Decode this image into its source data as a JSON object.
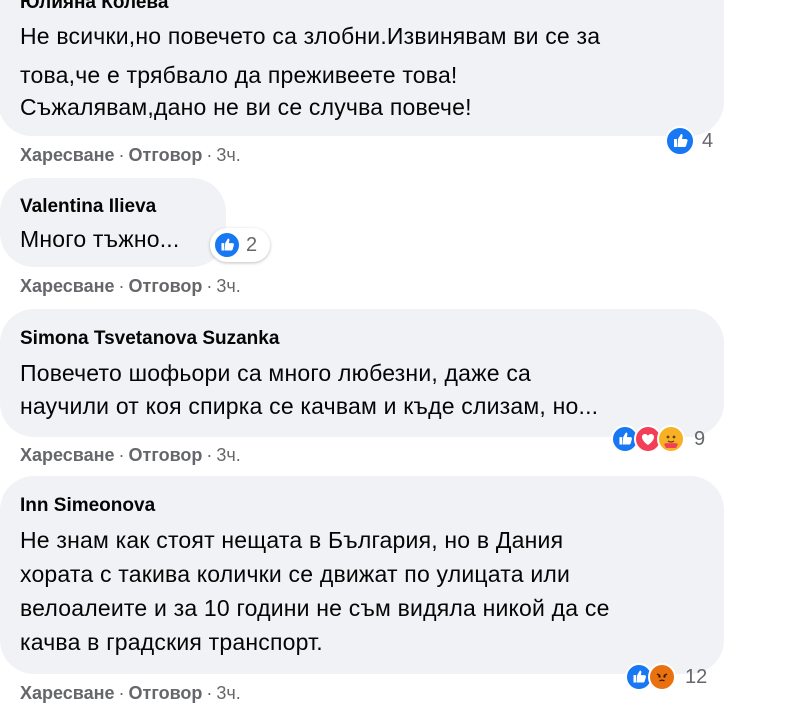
{
  "colors": {
    "bubble_bg": "#f0f2f5",
    "text": "#050505",
    "meta": "#65676b",
    "like_blue": "#1877f2",
    "love_red": "#f33e58",
    "care_yellow": "#f7b125",
    "angry_orange": "#e9710f"
  },
  "comments": [
    {
      "author": "Юлияна Колева",
      "lines": [
        "Не всички,но повечето са злобни.Извинявам ви се за",
        "това,че е трябвало да преживеете това!",
        "Съжалявам,дано не ви се случва повече!"
      ],
      "like_label": "Харесване",
      "reply_label": "Отговор",
      "time": "3ч.",
      "reactions": [
        "like-icon"
      ],
      "reaction_count": "4"
    },
    {
      "author": "Valentina Ilieva",
      "lines": [
        "Много тъжно..."
      ],
      "like_label": "Харесване",
      "reply_label": "Отговор",
      "time": "3ч.",
      "reactions": [
        "like-icon"
      ],
      "reaction_count": "2"
    },
    {
      "author": "Simona Tsvetanova Suzanka",
      "lines": [
        "Повечето шофьори са много любезни, даже са",
        "научили от коя спирка се качвам и къде слизам, но..."
      ],
      "like_label": "Харесване",
      "reply_label": "Отговор",
      "time": "3ч.",
      "reactions": [
        "like-icon",
        "love-icon",
        "care-icon"
      ],
      "reaction_count": "9"
    },
    {
      "author": "Inn Simeonova",
      "lines": [
        "Не знам как стоят нещата в България, но в Дания",
        "хората с такива колички се движат по улицата или",
        "велоалеите и за 10 години не съм видяла никой да се",
        "качва в градския транспорт."
      ],
      "like_label": "Харесване",
      "reply_label": "Отговор",
      "time": "3ч.",
      "reactions": [
        "like-icon",
        "angry-icon"
      ],
      "reaction_count": "12"
    }
  ]
}
